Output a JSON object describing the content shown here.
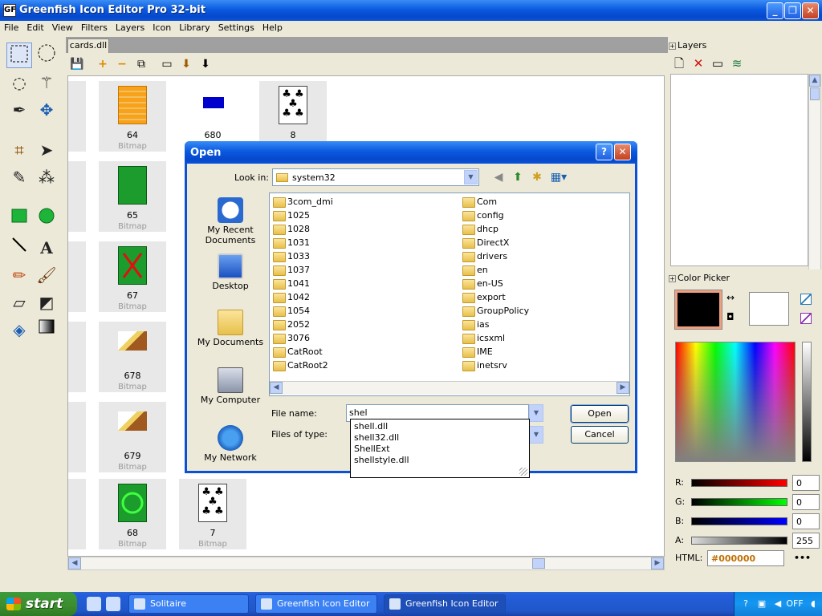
{
  "window": {
    "title": "Greenfish Icon Editor Pro 32-bit",
    "app_icon": "GF",
    "controls": {
      "minimize": "_",
      "maximize": "❐",
      "close": "✕"
    }
  },
  "menu": [
    "File",
    "Edit",
    "View",
    "Filters",
    "Layers",
    "Icon",
    "Library",
    "Settings",
    "Help"
  ],
  "document": {
    "tab": "cards.dll",
    "icons": [
      {
        "num": "64",
        "kind": "Bitmap"
      },
      {
        "num": "680",
        "kind": ""
      },
      {
        "num": "8",
        "kind": ""
      },
      {
        "num": "65",
        "kind": "Bitmap"
      },
      {
        "num": "67",
        "kind": "Bitmap"
      },
      {
        "num": "678",
        "kind": "Bitmap"
      },
      {
        "num": "679",
        "kind": "Bitmap"
      },
      {
        "num": "68",
        "kind": "Bitmap"
      },
      {
        "num": "7",
        "kind": "Bitmap"
      }
    ]
  },
  "layers_panel": {
    "title": "Layers",
    "toggle": "+"
  },
  "color_picker": {
    "title": "Color Picker",
    "toggle": "+",
    "primary": "#000000",
    "secondary": "#ffffff",
    "channels": [
      {
        "label": "R:",
        "value": "0",
        "color": "#ff0000"
      },
      {
        "label": "G:",
        "value": "0",
        "color": "#00ff00"
      },
      {
        "label": "B:",
        "value": "0",
        "color": "#0000ff"
      },
      {
        "label": "A:",
        "value": "255",
        "color": "#000000"
      }
    ],
    "html_label": "HTML:",
    "html_value": "#000000",
    "more": "•••"
  },
  "dialog": {
    "title": "Open",
    "help": "?",
    "close": "✕",
    "look_in_label": "Look in:",
    "look_in_value": "system32",
    "places": [
      "My Recent Documents",
      "Desktop",
      "My Documents",
      "My Computer",
      "My Network"
    ],
    "folders_col1": [
      "3com_dmi",
      "1025",
      "1028",
      "1031",
      "1033",
      "1037",
      "1041",
      "1042",
      "1054",
      "2052",
      "3076",
      "CatRoot",
      "CatRoot2"
    ],
    "folders_col2": [
      "Com",
      "config",
      "dhcp",
      "DirectX",
      "drivers",
      "en",
      "en-US",
      "export",
      "GroupPolicy",
      "ias",
      "icsxml",
      "IME",
      "inetsrv"
    ],
    "file_name_label": "File name:",
    "file_name_value": "shel",
    "files_of_type_label": "Files of type:",
    "open_label": "Open",
    "cancel_label": "Cancel",
    "autocomplete": [
      "shell.dll",
      "shell32.dll",
      "ShellExt",
      "shellstyle.dll"
    ]
  },
  "taskbar": {
    "start_label": "start",
    "tasks": [
      {
        "label": "Solitaire",
        "active": false
      },
      {
        "label": "Greenfish Icon Editor ...",
        "active": false
      },
      {
        "label": "Greenfish Icon Editor ...",
        "active": true
      }
    ],
    "tray_text": "OFF"
  }
}
